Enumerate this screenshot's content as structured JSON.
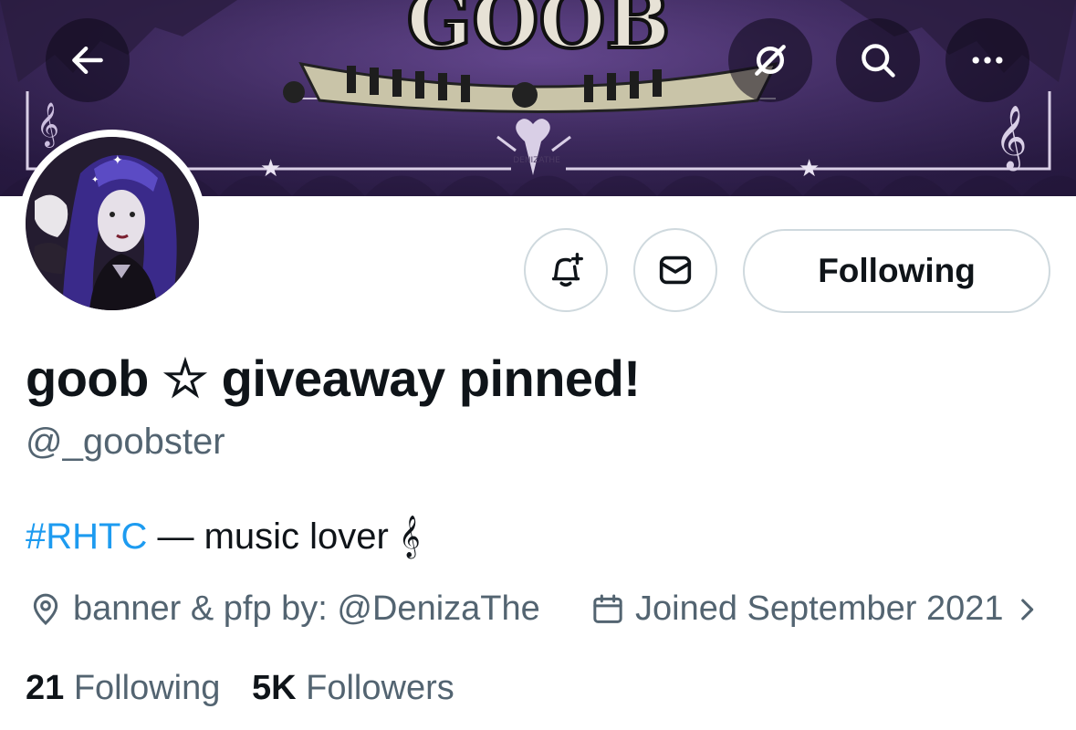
{
  "header": {
    "back_icon": "arrow-left-icon",
    "grok_icon": "slash-circle-icon",
    "search_icon": "search-icon",
    "more_icon": "ellipsis-icon",
    "banner_logo_text": "GOOB",
    "banner_signature": "DENIZATHE"
  },
  "profile": {
    "display_name": "goob ☆ giveaway pinned!",
    "handle": "@_goobster",
    "bio_hashtag": "#RHTC",
    "bio_rest": " — music lover 𝄞",
    "location": "banner & pfp by: @DenizaThe",
    "joined": "Joined September 2021",
    "following_count": "21",
    "following_label": " Following",
    "followers_count": "5K",
    "followers_label": " Followers"
  },
  "actions": {
    "notify_icon": "bell-plus-icon",
    "message_icon": "envelope-icon",
    "follow_label": "Following"
  },
  "colors": {
    "link": "#1d9bf0",
    "secondary_text": "#536471",
    "border": "#cfd9de",
    "banner_purple": "#3f2a62"
  }
}
